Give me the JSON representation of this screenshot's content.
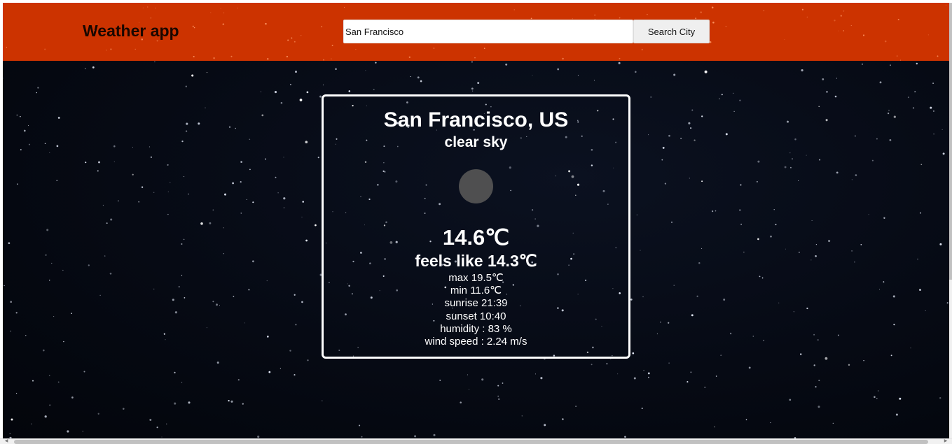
{
  "header": {
    "title": "Weather app",
    "search": {
      "value": "San Francisco",
      "button_label": "Search City"
    }
  },
  "weather": {
    "city": "San Francisco, US",
    "description": "clear sky",
    "icon": "moon-icon",
    "temperature": "14.6℃",
    "feels_like": "feels like 14.3℃",
    "details": [
      "max 19.5℃",
      "min 11.6℃",
      "sunrise 21:39",
      "sunset 10:40",
      "humidity : 83 %",
      "wind speed : 2.24 m/s"
    ]
  },
  "colors": {
    "header_bg": "#cc3300",
    "background": "#060a14",
    "card_border": "#ffffff"
  }
}
